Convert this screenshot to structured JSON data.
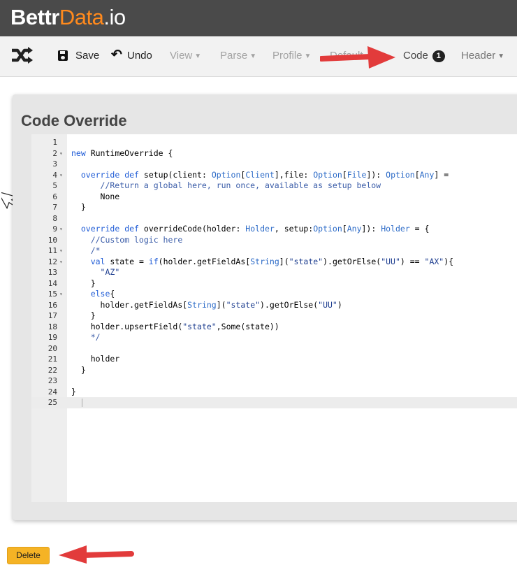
{
  "brand": {
    "part1": "Bettr",
    "part2": "Data",
    "part3": ".io"
  },
  "toolbar": {
    "save": "Save",
    "undo": "Undo",
    "view": "View",
    "parse": "Parse",
    "profile": "Profile",
    "default": "Default",
    "code": "Code",
    "code_count": "1",
    "header": "Header"
  },
  "panel": {
    "title": "Code Override"
  },
  "code_lines": [
    "",
    "new RuntimeOverride {",
    "",
    "  override def setup(client: Option[Client],file: Option[File]): Option[Any] =",
    "      //Return a global here, run once, available as setup below",
    "      None",
    "  }",
    "",
    "  override def overrideCode(holder: Holder, setup:Option[Any]): Holder = {",
    "    //Custom logic here",
    "    /*",
    "    val state = if(holder.getFieldAs[String](\"state\").getOrElse(\"UU\") == \"AX\"){",
    "      \"AZ\"",
    "    }",
    "    else{",
    "      holder.getFieldAs[String](\"state\").getOrElse(\"UU\")",
    "    }",
    "    holder.upsertField(\"state\",Some(state))",
    "    */",
    "",
    "    holder",
    "  }",
    "",
    "}",
    ""
  ],
  "line_numbers": [
    "1",
    "2",
    "3",
    "4",
    "5",
    "6",
    "7",
    "8",
    "9",
    "10",
    "11",
    "12",
    "13",
    "14",
    "15",
    "16",
    "17",
    "18",
    "19",
    "20",
    "21",
    "22",
    "23",
    "24",
    "25"
  ],
  "fold_markers": {
    "2": "▾",
    "4": "▾",
    "9": "▾",
    "11": "▾",
    "12": "▾",
    "15": "▾"
  },
  "delete_button": "Delete",
  "colors": {
    "accent_orange": "#ff8a1d",
    "delete_yellow": "#f5b325",
    "arrow_red": "#e23b3b",
    "keyword_blue": "#1e5bd6"
  }
}
